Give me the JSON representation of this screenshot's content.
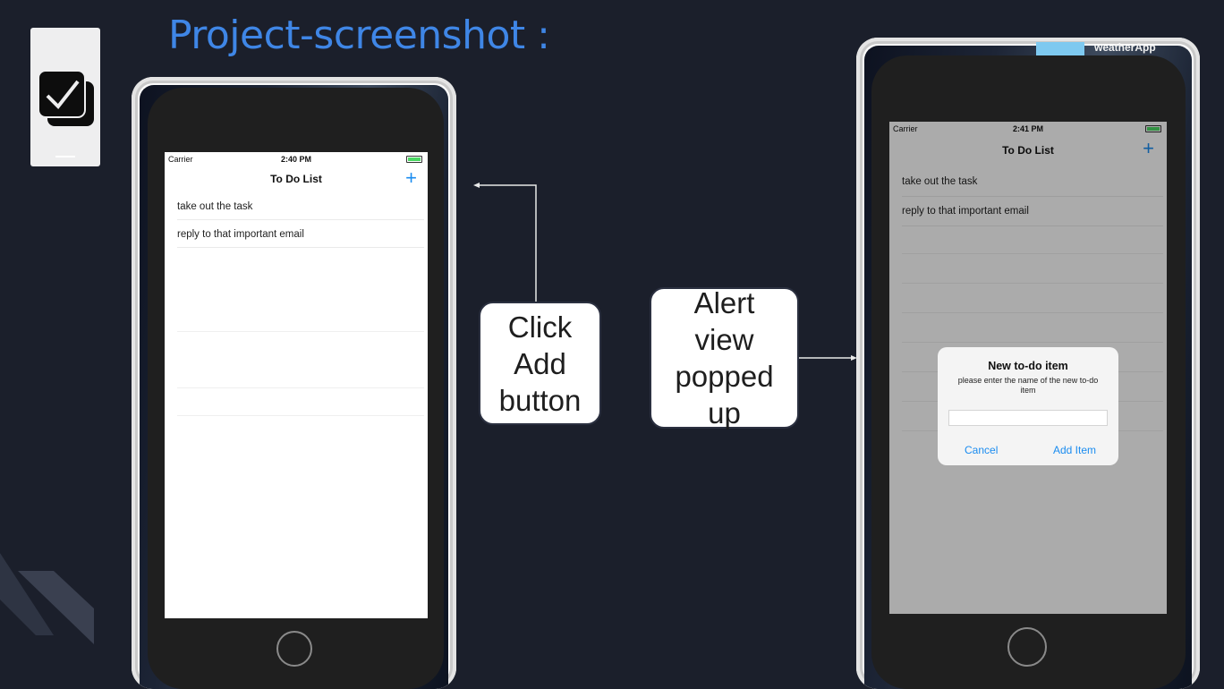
{
  "slide": {
    "title": "Project-screenshot :"
  },
  "app_icon": {
    "name": "checkbox-stack-icon"
  },
  "left_phone": {
    "status": {
      "carrier": "Carrier",
      "time": "2:40 PM"
    },
    "nav_title": "To Do List",
    "add_button": "+",
    "items": [
      "take out the task",
      "reply to that important email"
    ]
  },
  "right_phone": {
    "top_banner": "weatherApp",
    "status": {
      "carrier": "Carrier",
      "time": "2:41 PM"
    },
    "nav_title": "To Do List",
    "add_button": "+",
    "items": [
      "take out the task",
      "reply to that important email"
    ],
    "alert": {
      "title": "New to-do item",
      "message": "please enter the name of the new to-do item",
      "input_value": "",
      "cancel_label": "Cancel",
      "add_label": "Add Item"
    }
  },
  "callouts": {
    "click_add": "Click Add button",
    "alert_popped": "Alert view popped up"
  },
  "colors": {
    "background": "#1b1f2b",
    "title": "#3f86e6",
    "ios_tint": "#1a8cf0",
    "battery": "#4cd964"
  }
}
